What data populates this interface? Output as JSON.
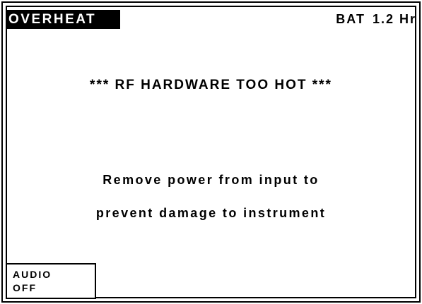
{
  "header": {
    "title": "OVERHEAT",
    "battery_label": "BAT",
    "battery_value": "1.2 Hr"
  },
  "alert": {
    "message": "***  RF HARDWARE TOO HOT  ***",
    "instruction_line1": "Remove power from input to",
    "instruction_line2": "prevent damage to instrument"
  },
  "softkeys": [
    {
      "line1": "AUDIO",
      "line2": "OFF"
    }
  ],
  "colors": {
    "background": "#ffffff",
    "foreground": "#000000",
    "title_bg": "#000000",
    "title_text": "#ffffff"
  }
}
